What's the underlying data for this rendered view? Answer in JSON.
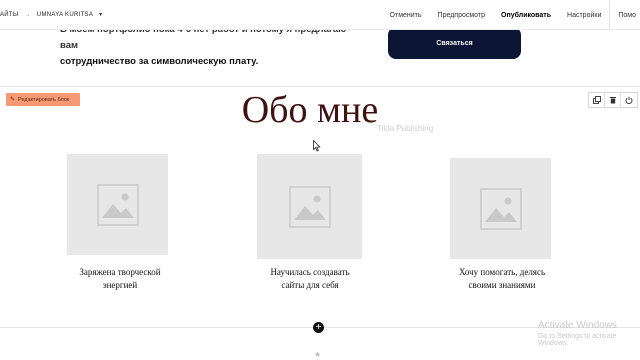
{
  "topbar": {
    "crumb_left": "АЙТЫ",
    "crumb_separator": "→",
    "crumb_project": "UMNAYA KURITSA",
    "crumb_chevron_icon": "chevron-down-icon",
    "actions": [
      "Отменить",
      "Предпросмотр",
      "Опубликовать",
      "Настройки",
      "Помо"
    ]
  },
  "prev_block": {
    "text_line1": "В моём портфолио пока 4-6 нет работ и потому я предлагаю вам",
    "text_line2": "сотрудничество за символическую плату.",
    "button": "Связаться",
    "button_color": "#0c1533"
  },
  "block": {
    "edit_button": "Редактировать блок",
    "edit_icon": "pencil-icon",
    "edit_color": "#f79a73",
    "tools": [
      "copy-icon",
      "trash-icon",
      "power-icon"
    ],
    "heading": "Обо мне",
    "watermark": "Tilda Publishing",
    "cards": [
      {
        "line1": "Заряжена творческой",
        "line2": "энергией"
      },
      {
        "line1": "Научилась создавать",
        "line2": "сайты для себя"
      },
      {
        "line1": "Хочу помогать, делясь",
        "line2": "своими знаниями"
      }
    ]
  },
  "add_button": "+",
  "star": "★",
  "os_watermark": {
    "title": "Activate Windows",
    "subtitle": "Go to Settings to activate Windows."
  }
}
